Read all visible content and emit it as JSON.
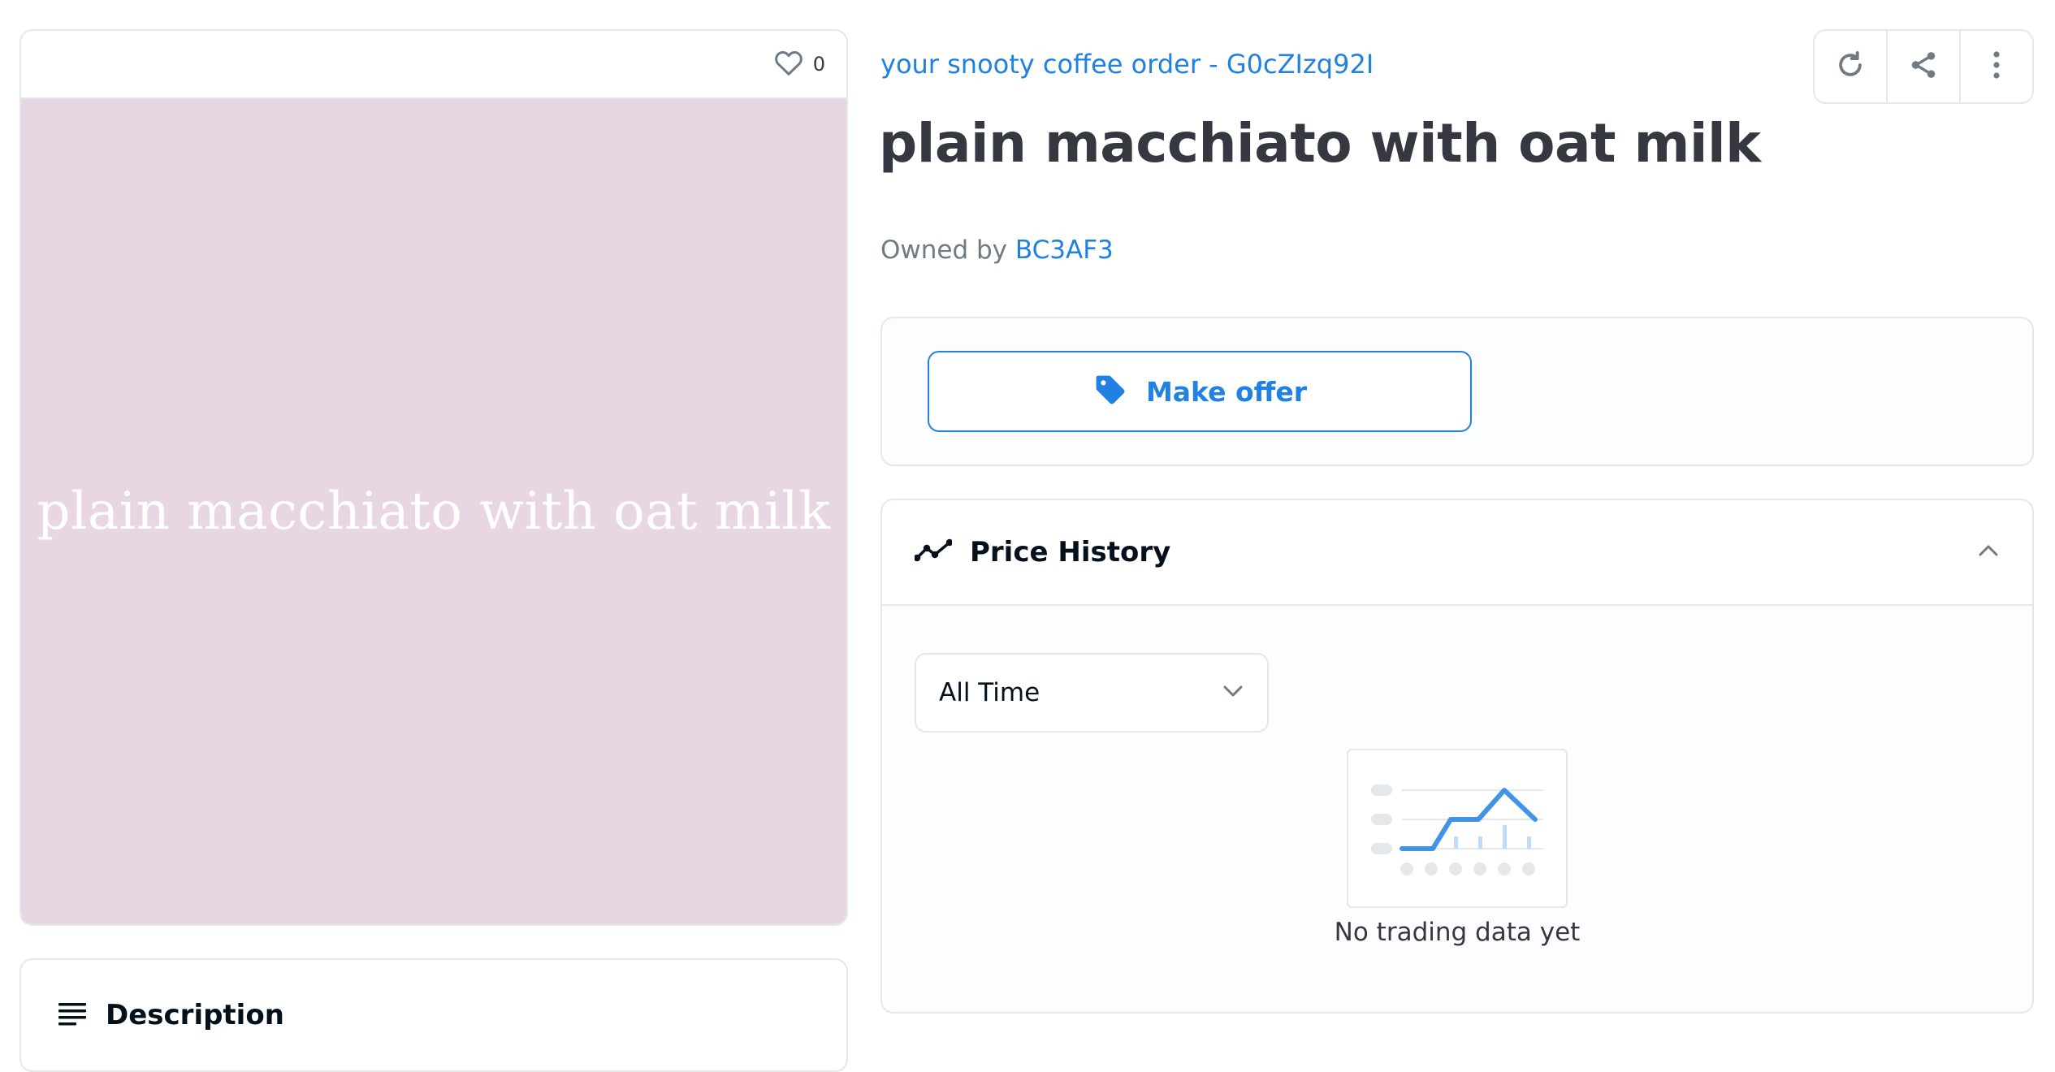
{
  "favorites": {
    "count": "0",
    "icon": "heart-icon"
  },
  "media": {
    "text": "plain macchiato with oat milk",
    "background": "#e8d7e2"
  },
  "description": {
    "title": "Description",
    "icon": "list-icon"
  },
  "collection": {
    "label": "your snooty coffee order - G0cZIzq92I"
  },
  "actions": {
    "refresh_icon": "refresh-icon",
    "share_icon": "share-icon",
    "more_icon": "more-vertical-icon"
  },
  "item": {
    "title": "plain macchiato with oat milk",
    "owned_by_label": "Owned by",
    "owner": "BC3AF3"
  },
  "offer": {
    "label": "Make offer",
    "icon": "tag-icon"
  },
  "price_history": {
    "title": "Price History",
    "icon": "trending-line-icon",
    "time_filter": "All Time",
    "empty_text": "No trading data yet"
  },
  "colors": {
    "accent": "#2081e2",
    "text": "#353840",
    "muted": "#707a83",
    "border": "#e5e8eb"
  }
}
